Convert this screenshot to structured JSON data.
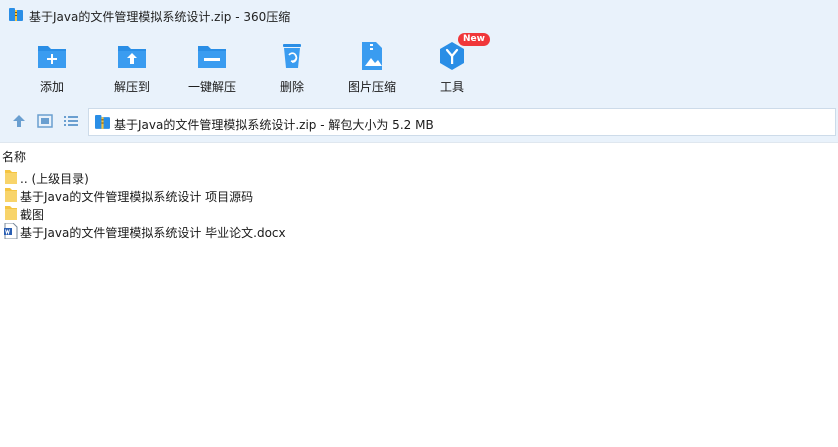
{
  "window": {
    "title": "基于Java的文件管理模拟系统设计.zip - 360压缩"
  },
  "toolbar": {
    "items": [
      {
        "label": "添加",
        "icon": "folder-add-icon"
      },
      {
        "label": "解压到",
        "icon": "folder-extract-icon"
      },
      {
        "label": "一键解压",
        "icon": "folder-oneclick-icon"
      },
      {
        "label": "删除",
        "icon": "recycle-bin-icon"
      },
      {
        "label": "图片压缩",
        "icon": "image-compress-icon"
      },
      {
        "label": "工具",
        "icon": "tools-icon",
        "badge": "New"
      }
    ]
  },
  "address": {
    "path": "基于Java的文件管理模拟系统设计.zip - 解包大小为 5.2 MB"
  },
  "list": {
    "column_name": "名称",
    "rows": [
      {
        "name": ".. (上级目录)",
        "type": "folder"
      },
      {
        "name": "基于Java的文件管理模拟系统设计 项目源码",
        "type": "folder"
      },
      {
        "name": "截图",
        "type": "folder"
      },
      {
        "name": "基于Java的文件管理模拟系统设计 毕业论文.docx",
        "type": "docx"
      }
    ]
  },
  "colors": {
    "accent": "#2a8ee6",
    "toolbar_bg": "#e9f2fb",
    "folder": "#f5c542",
    "badge": "#f0373a"
  }
}
